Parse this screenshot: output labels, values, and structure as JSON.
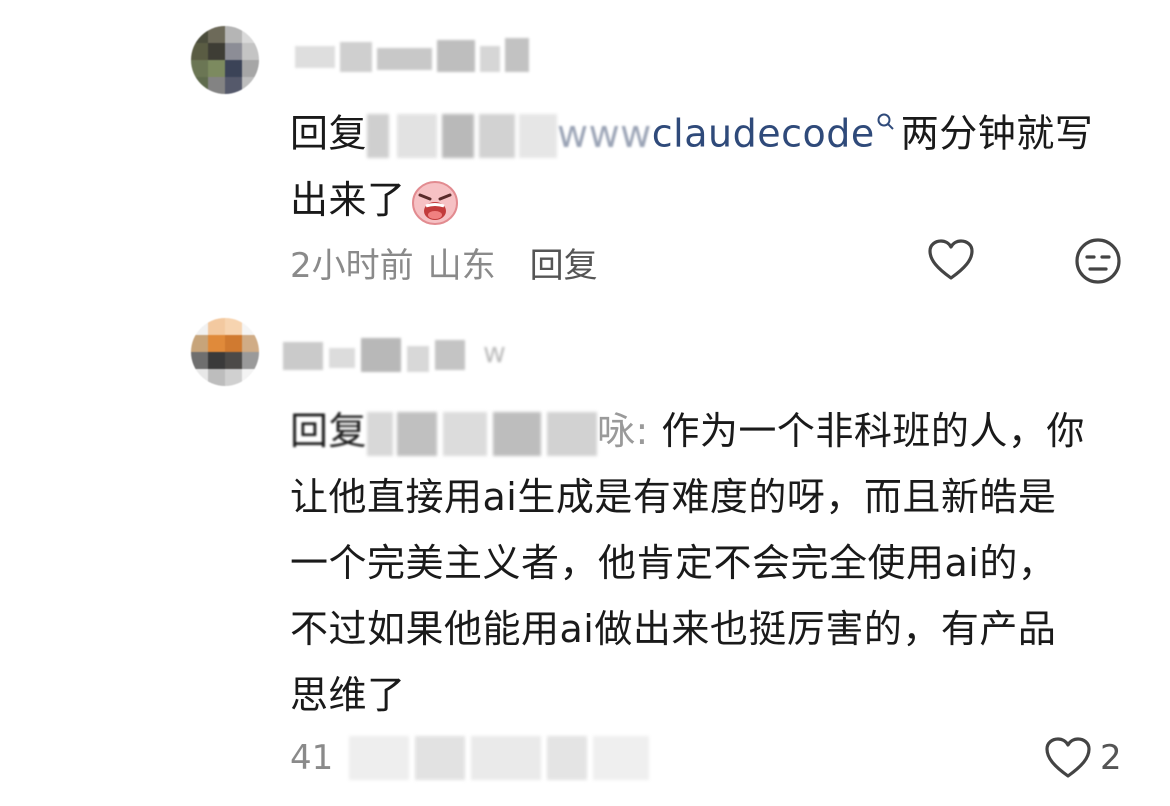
{
  "comments": [
    {
      "reply_prefix": "回复",
      "reply_target_suffix": "www",
      "link_text": "claudecode",
      "text_line1_tail": "两分钟就写",
      "text_line2": "出来了",
      "emoji_icon": "crying-emoji-icon",
      "time": "2小时前",
      "location": "山东",
      "reply_label": "回复",
      "like_icon": "heart-outline-icon",
      "dislike_icon": "meh-face-icon"
    },
    {
      "reply_prefix": "回复",
      "username_suffix": "w",
      "reply_target_suffix": "咏:",
      "lines": [
        "作为一个非科班的人，你",
        "让他直接用ai生成是有难度的呀，而且新皓是",
        "一个完美主义者，他肯定不会完全使用ai的，",
        "不过如果他能用ai做出来也挺厉害的，有产品",
        "思维了"
      ],
      "time_partial": "41",
      "like_icon": "heart-outline-icon",
      "like_count": "2"
    }
  ],
  "colors": {
    "link": "#2f4a7a",
    "meta_text": "#8a8a8a",
    "body_text": "#1a1a1a"
  }
}
